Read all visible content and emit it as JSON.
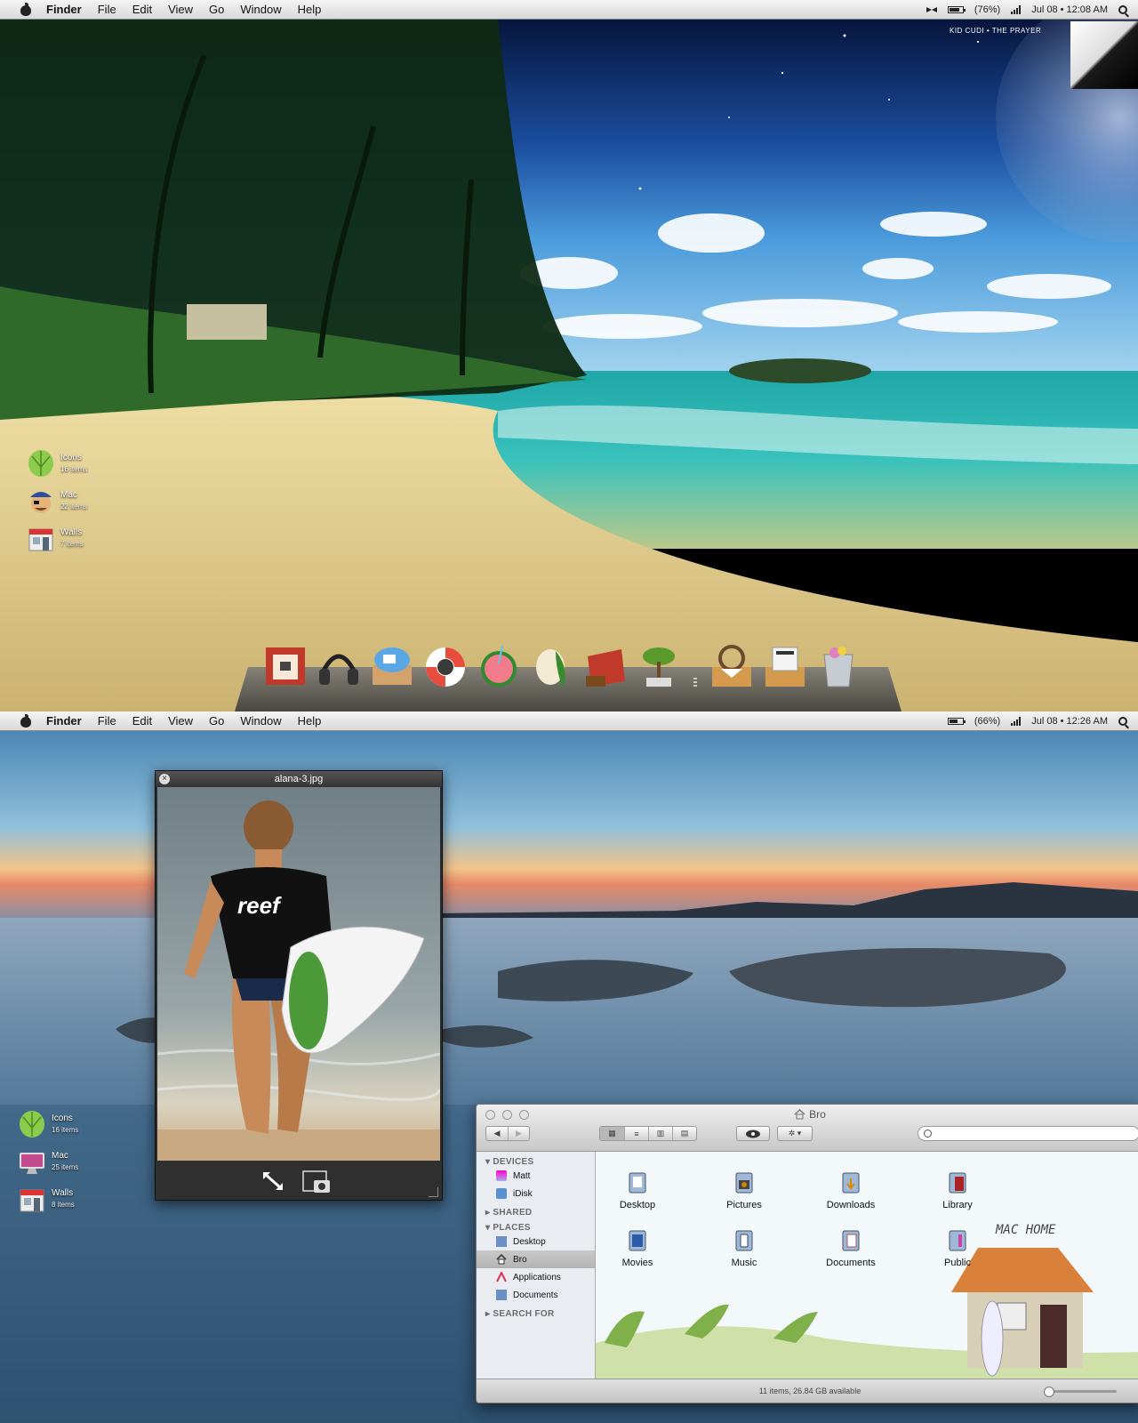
{
  "screen1": {
    "menubar": {
      "items": [
        "Finder",
        "File",
        "Edit",
        "View",
        "Go",
        "Window",
        "Help"
      ],
      "battery_pct": "(76%)",
      "battery_level": 0.76,
      "datetime": "Jul 08 • 12:08 AM"
    },
    "wallpaper_credit": "KID CUDI • THE PRAYER",
    "desktop_icons": [
      {
        "label": "Icons",
        "sub": "16 items",
        "icon": "leaf-icon"
      },
      {
        "label": "Mac",
        "sub": "22 items",
        "icon": "pirate-icon"
      },
      {
        "label": "Walls",
        "sub": "7 items",
        "icon": "store-icon"
      }
    ],
    "dock": [
      "theater-icon",
      "headphones-icon",
      "ichat-icon",
      "lifebuoy-icon",
      "watermelon-icon",
      "egg-leaf-icon",
      "topic-bag-icon",
      "bonsai-icon",
      "ship-wheel-box-icon",
      "times-news-box-icon",
      "trash-icon"
    ]
  },
  "screen2": {
    "menubar": {
      "items": [
        "Finder",
        "File",
        "Edit",
        "View",
        "Go",
        "Window",
        "Help"
      ],
      "battery_pct": "(66%)",
      "battery_level": 0.66,
      "datetime": "Jul 08 • 12:26 AM"
    },
    "desktop_icons": [
      {
        "label": "Icons",
        "sub": "16 items",
        "icon": "leaf-icon"
      },
      {
        "label": "Mac",
        "sub": "25 items",
        "icon": "imac-icon"
      },
      {
        "label": "Walls",
        "sub": "8 items",
        "icon": "store-icon"
      }
    ],
    "preview": {
      "title": "alana-3.jpg",
      "shirt_text": "reef"
    },
    "finder": {
      "title": "Bro",
      "sidebar": {
        "devices_header": "DEVICES",
        "devices": [
          "Matt",
          "iDisk"
        ],
        "shared_header": "SHARED",
        "places_header": "PLACES",
        "places": [
          "Desktop",
          "Bro",
          "Applications",
          "Documents"
        ],
        "search_header": "SEARCH FOR"
      },
      "items": [
        "Desktop",
        "Pictures",
        "Downloads",
        "Library",
        "Movies",
        "Music",
        "Documents",
        "Public"
      ],
      "background_label": "MAC HOME",
      "status": "11 items, 26.84 GB available"
    }
  }
}
